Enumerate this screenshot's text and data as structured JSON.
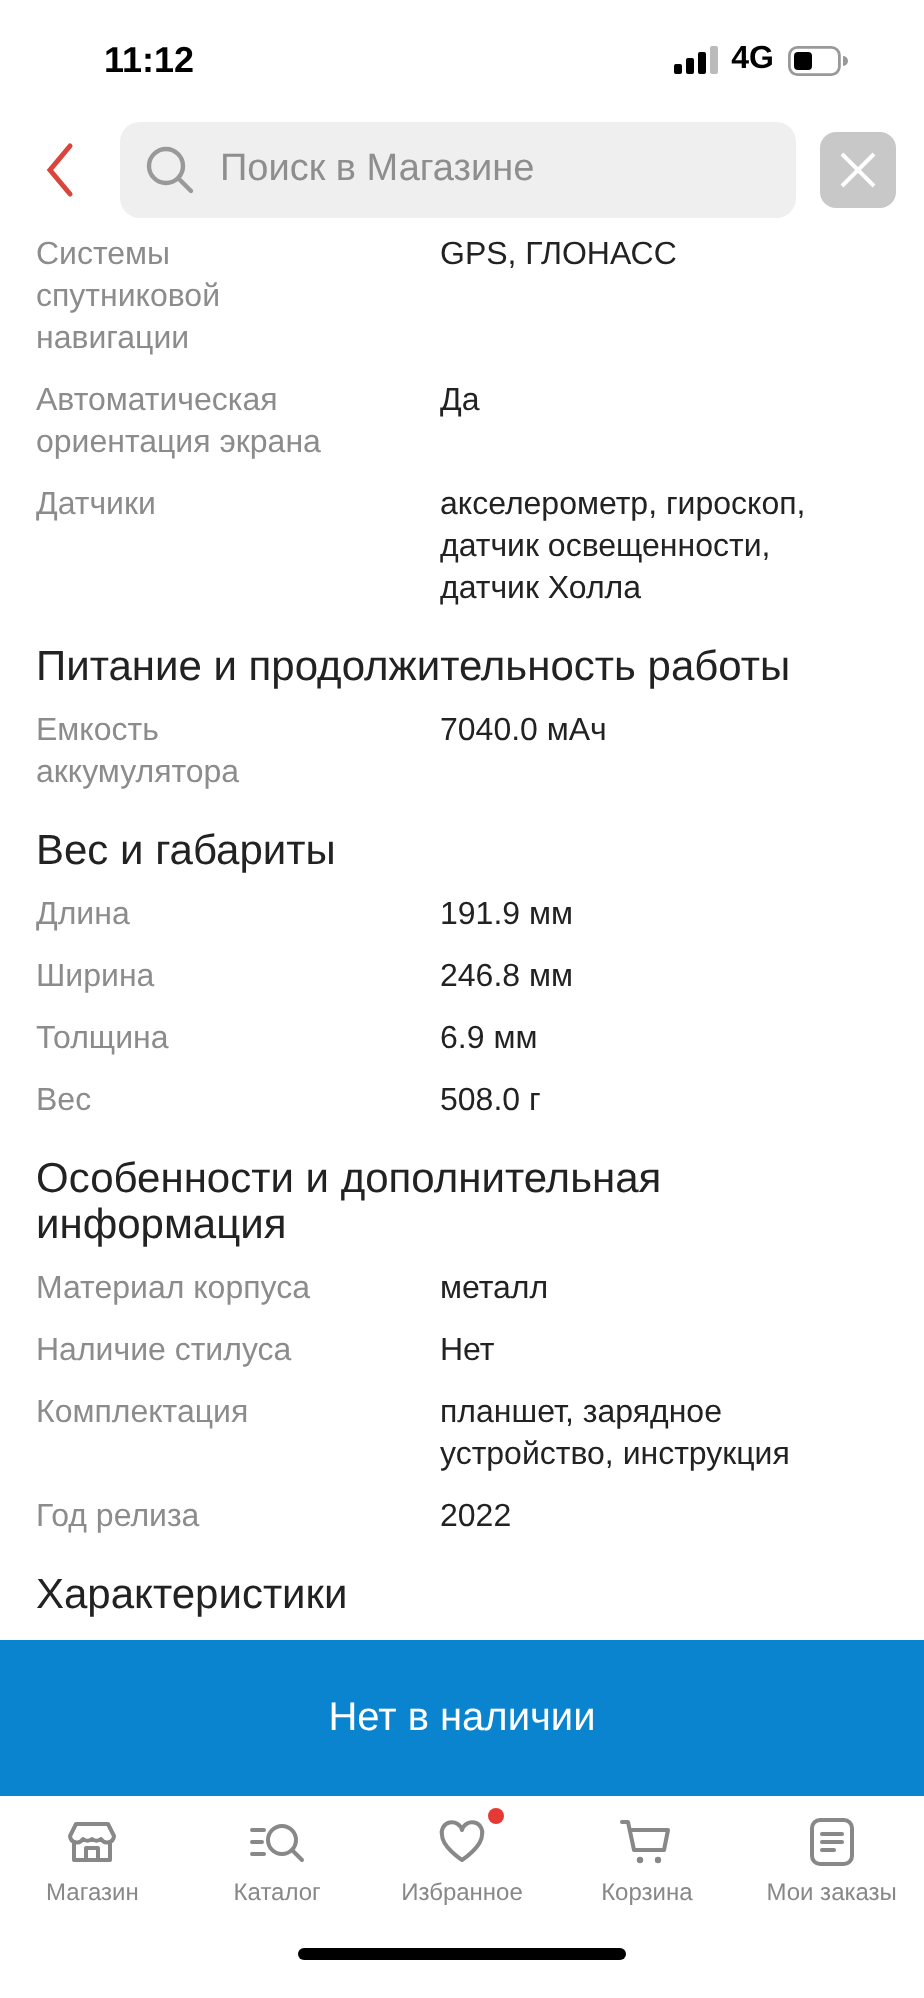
{
  "status_bar": {
    "time": "11:12",
    "network": "4G"
  },
  "header": {
    "search": {
      "placeholder": "Поиск в Магазине"
    }
  },
  "sections": [
    {
      "rows": [
        {
          "label": "Системы спутниковой навигации",
          "value": "GPS, ГЛОНАСС"
        },
        {
          "label": "Автоматическая ориентация экрана",
          "value": "Да"
        },
        {
          "label": "Датчики",
          "value": "акселерометр, гироскоп, датчик освещенности, датчик Холла"
        }
      ]
    },
    {
      "title": "Питание и продолжительность работы",
      "rows": [
        {
          "label": "Емкость аккумулятора",
          "value": "7040.0 мАч"
        }
      ]
    },
    {
      "title": "Вес и габариты",
      "rows": [
        {
          "label": "Длина",
          "value": "191.9 мм"
        },
        {
          "label": "Ширина",
          "value": "246.8 мм"
        },
        {
          "label": "Толщина",
          "value": "6.9 мм"
        },
        {
          "label": "Вес",
          "value": "508.0 г"
        }
      ]
    },
    {
      "title": "Особенности и дополнительная информация",
      "rows": [
        {
          "label": "Материал корпуса",
          "value": "металл"
        },
        {
          "label": "Наличие стилуса",
          "value": "Нет"
        },
        {
          "label": "Комплектация",
          "value": "планшет, зарядное устройство, инструкция"
        },
        {
          "label": "Год релиза",
          "value": "2022"
        }
      ]
    },
    {
      "title": "Характеристики"
    }
  ],
  "action_button": {
    "label": "Нет в наличии"
  },
  "tab_bar": [
    {
      "kind": "store",
      "label": "Магазин",
      "badge": false
    },
    {
      "kind": "catalog",
      "label": "Каталог",
      "badge": false
    },
    {
      "kind": "favorites",
      "label": "Избранное",
      "badge": true
    },
    {
      "kind": "cart",
      "label": "Корзина",
      "badge": false
    },
    {
      "kind": "orders",
      "label": "Мои заказы",
      "badge": false
    }
  ]
}
